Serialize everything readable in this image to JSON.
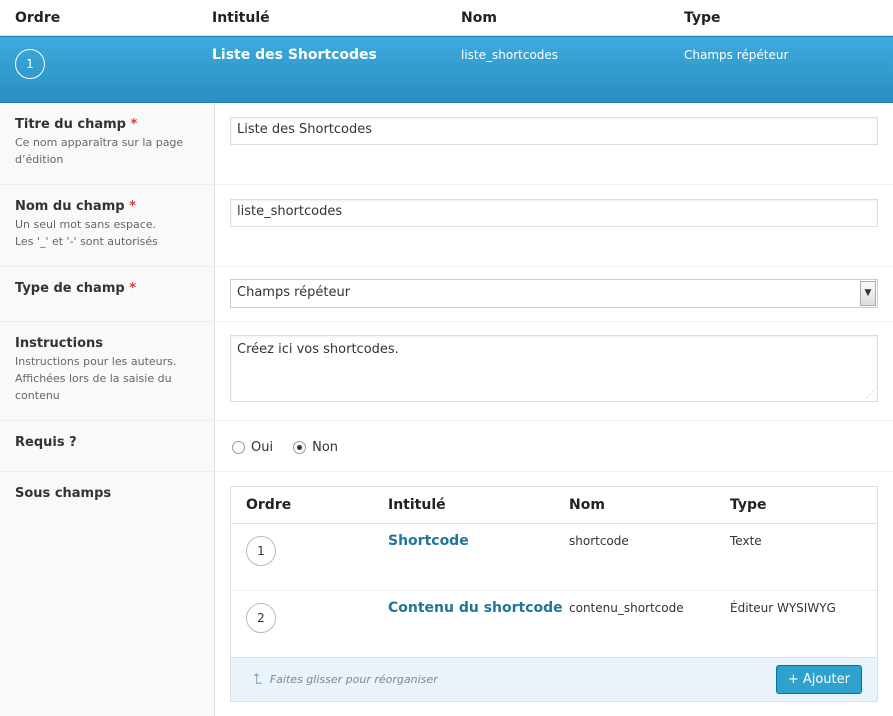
{
  "header": {
    "col_order": "Ordre",
    "col_title": "Intitulé",
    "col_name": "Nom",
    "col_type": "Type"
  },
  "active_field": {
    "order": "1",
    "title": "Liste des Shortcodes",
    "name": "liste_shortcodes",
    "type": "Champs répéteur"
  },
  "form": {
    "field_title": {
      "label": "Titre du champ",
      "required": "*",
      "desc": "Ce nom apparaîtra sur la page d’édition",
      "value": "Liste des Shortcodes"
    },
    "field_name": {
      "label": "Nom du champ",
      "required": "*",
      "desc_line1": "Un seul mot sans espace.",
      "desc_line2": "Les '_' et '-' sont autorisés",
      "value": "liste_shortcodes"
    },
    "field_type": {
      "label": "Type de champ",
      "required": "*",
      "value": "Champs répéteur"
    },
    "instructions": {
      "label": "Instructions",
      "desc": "Instructions pour les auteurs. Affichées lors de la saisie du contenu",
      "value": "Créez ici vos shortcodes."
    },
    "required": {
      "label": "Requis ?",
      "option_yes": "Oui",
      "option_no": "Non",
      "selected": "Non"
    },
    "subfields": {
      "label": "Sous champs"
    }
  },
  "subtable": {
    "col_order": "Ordre",
    "col_title": "Intitulé",
    "col_name": "Nom",
    "col_type": "Type",
    "rows": [
      {
        "order": "1",
        "title": "Shortcode",
        "name": "shortcode",
        "type": "Texte"
      },
      {
        "order": "2",
        "title": "Contenu du shortcode",
        "name": "contenu_shortcode",
        "type": "Éditeur WYSIWYG"
      }
    ],
    "hint": "Faites glisser pour réorganiser",
    "add_button": "+ Ajouter"
  }
}
